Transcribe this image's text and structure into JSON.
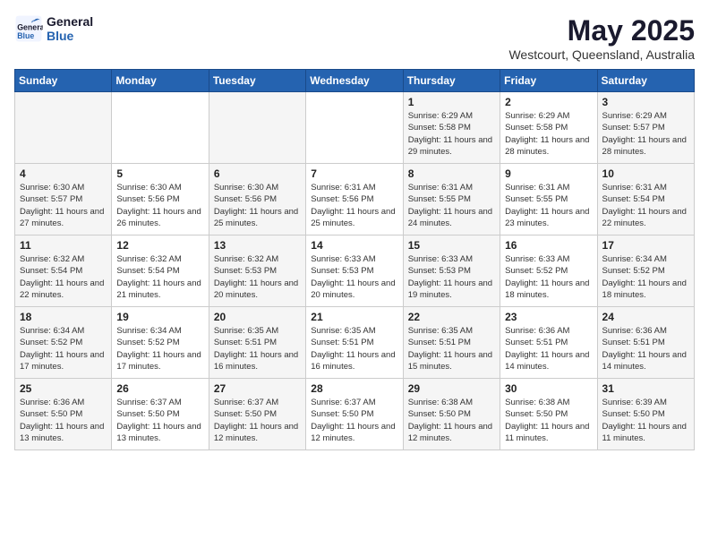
{
  "logo": {
    "line1": "General",
    "line2": "Blue"
  },
  "title": "May 2025",
  "location": "Westcourt, Queensland, Australia",
  "days_of_week": [
    "Sunday",
    "Monday",
    "Tuesday",
    "Wednesday",
    "Thursday",
    "Friday",
    "Saturday"
  ],
  "weeks": [
    [
      {
        "day": "",
        "info": ""
      },
      {
        "day": "",
        "info": ""
      },
      {
        "day": "",
        "info": ""
      },
      {
        "day": "",
        "info": ""
      },
      {
        "day": "1",
        "info": "Sunrise: 6:29 AM\nSunset: 5:58 PM\nDaylight: 11 hours and 29 minutes."
      },
      {
        "day": "2",
        "info": "Sunrise: 6:29 AM\nSunset: 5:58 PM\nDaylight: 11 hours and 28 minutes."
      },
      {
        "day": "3",
        "info": "Sunrise: 6:29 AM\nSunset: 5:57 PM\nDaylight: 11 hours and 28 minutes."
      }
    ],
    [
      {
        "day": "4",
        "info": "Sunrise: 6:30 AM\nSunset: 5:57 PM\nDaylight: 11 hours and 27 minutes."
      },
      {
        "day": "5",
        "info": "Sunrise: 6:30 AM\nSunset: 5:56 PM\nDaylight: 11 hours and 26 minutes."
      },
      {
        "day": "6",
        "info": "Sunrise: 6:30 AM\nSunset: 5:56 PM\nDaylight: 11 hours and 25 minutes."
      },
      {
        "day": "7",
        "info": "Sunrise: 6:31 AM\nSunset: 5:56 PM\nDaylight: 11 hours and 25 minutes."
      },
      {
        "day": "8",
        "info": "Sunrise: 6:31 AM\nSunset: 5:55 PM\nDaylight: 11 hours and 24 minutes."
      },
      {
        "day": "9",
        "info": "Sunrise: 6:31 AM\nSunset: 5:55 PM\nDaylight: 11 hours and 23 minutes."
      },
      {
        "day": "10",
        "info": "Sunrise: 6:31 AM\nSunset: 5:54 PM\nDaylight: 11 hours and 22 minutes."
      }
    ],
    [
      {
        "day": "11",
        "info": "Sunrise: 6:32 AM\nSunset: 5:54 PM\nDaylight: 11 hours and 22 minutes."
      },
      {
        "day": "12",
        "info": "Sunrise: 6:32 AM\nSunset: 5:54 PM\nDaylight: 11 hours and 21 minutes."
      },
      {
        "day": "13",
        "info": "Sunrise: 6:32 AM\nSunset: 5:53 PM\nDaylight: 11 hours and 20 minutes."
      },
      {
        "day": "14",
        "info": "Sunrise: 6:33 AM\nSunset: 5:53 PM\nDaylight: 11 hours and 20 minutes."
      },
      {
        "day": "15",
        "info": "Sunrise: 6:33 AM\nSunset: 5:53 PM\nDaylight: 11 hours and 19 minutes."
      },
      {
        "day": "16",
        "info": "Sunrise: 6:33 AM\nSunset: 5:52 PM\nDaylight: 11 hours and 18 minutes."
      },
      {
        "day": "17",
        "info": "Sunrise: 6:34 AM\nSunset: 5:52 PM\nDaylight: 11 hours and 18 minutes."
      }
    ],
    [
      {
        "day": "18",
        "info": "Sunrise: 6:34 AM\nSunset: 5:52 PM\nDaylight: 11 hours and 17 minutes."
      },
      {
        "day": "19",
        "info": "Sunrise: 6:34 AM\nSunset: 5:52 PM\nDaylight: 11 hours and 17 minutes."
      },
      {
        "day": "20",
        "info": "Sunrise: 6:35 AM\nSunset: 5:51 PM\nDaylight: 11 hours and 16 minutes."
      },
      {
        "day": "21",
        "info": "Sunrise: 6:35 AM\nSunset: 5:51 PM\nDaylight: 11 hours and 16 minutes."
      },
      {
        "day": "22",
        "info": "Sunrise: 6:35 AM\nSunset: 5:51 PM\nDaylight: 11 hours and 15 minutes."
      },
      {
        "day": "23",
        "info": "Sunrise: 6:36 AM\nSunset: 5:51 PM\nDaylight: 11 hours and 14 minutes."
      },
      {
        "day": "24",
        "info": "Sunrise: 6:36 AM\nSunset: 5:51 PM\nDaylight: 11 hours and 14 minutes."
      }
    ],
    [
      {
        "day": "25",
        "info": "Sunrise: 6:36 AM\nSunset: 5:50 PM\nDaylight: 11 hours and 13 minutes."
      },
      {
        "day": "26",
        "info": "Sunrise: 6:37 AM\nSunset: 5:50 PM\nDaylight: 11 hours and 13 minutes."
      },
      {
        "day": "27",
        "info": "Sunrise: 6:37 AM\nSunset: 5:50 PM\nDaylight: 11 hours and 12 minutes."
      },
      {
        "day": "28",
        "info": "Sunrise: 6:37 AM\nSunset: 5:50 PM\nDaylight: 11 hours and 12 minutes."
      },
      {
        "day": "29",
        "info": "Sunrise: 6:38 AM\nSunset: 5:50 PM\nDaylight: 11 hours and 12 minutes."
      },
      {
        "day": "30",
        "info": "Sunrise: 6:38 AM\nSunset: 5:50 PM\nDaylight: 11 hours and 11 minutes."
      },
      {
        "day": "31",
        "info": "Sunrise: 6:39 AM\nSunset: 5:50 PM\nDaylight: 11 hours and 11 minutes."
      }
    ]
  ]
}
